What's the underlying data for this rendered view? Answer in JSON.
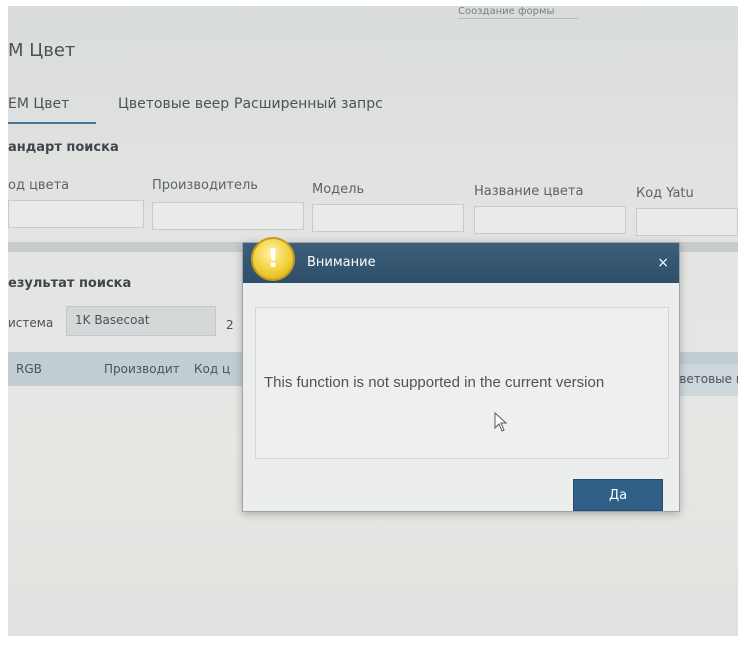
{
  "window": {
    "top_strip_text": "Соoздание формы",
    "app_title": "M Цвет"
  },
  "tabs": [
    {
      "label": "ЕМ Цвет"
    },
    {
      "label": "Цветовые веер"
    },
    {
      "label": "Расширенный запрс"
    }
  ],
  "search": {
    "section_title": "андарт поиска",
    "fields": [
      {
        "label": "од цвета",
        "value": ""
      },
      {
        "label": "Производитель",
        "value": ""
      },
      {
        "label": "Модель",
        "value": ""
      },
      {
        "label": "Название цвета",
        "value": ""
      },
      {
        "label": "Код Yatu",
        "value": ""
      }
    ]
  },
  "results": {
    "section_title": "езультат поиска",
    "system_label": "истема",
    "system_value": "1K Basecoat",
    "extra_value": "2",
    "columns": [
      "RGB",
      "Производит",
      "Код ц"
    ],
    "right_column": "Цветовые ве"
  },
  "dialog": {
    "title": "Внимание",
    "close_glyph": "×",
    "icon_glyph": "!",
    "message": "This function is not supported in the current version",
    "ok_label": "Да"
  },
  "colors": {
    "titlebar": "#2f4f69",
    "ok_button": "#2f5f86",
    "warning_icon": "#f2cf3a"
  }
}
